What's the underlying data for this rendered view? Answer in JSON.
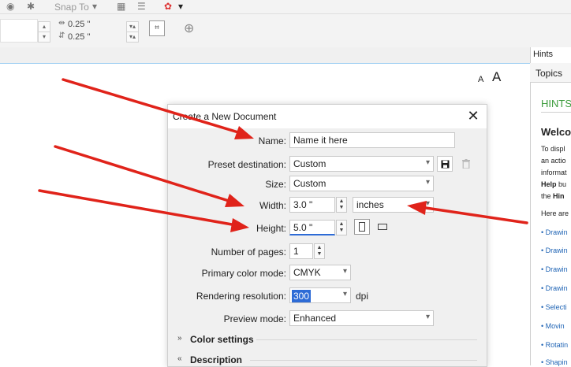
{
  "toolbar": {
    "snap_to_label": "Snap To",
    "nudge_x": "0.25 \"",
    "nudge_y": "0.25 \"",
    "add_icon": "plus-circle-icon"
  },
  "font_size": {
    "small": "A",
    "large": "A"
  },
  "hints": {
    "panel_title": "Hints",
    "tab_label": "Topics",
    "heading": "HINTS",
    "welcome": "Welco",
    "body_lines": [
      "To displ",
      "an actio",
      "informat"
    ],
    "help_line_bold": "Help",
    "help_line_rest": " bu",
    "hint_line_prefix": "the ",
    "hint_line_bold": "Hin",
    "here_line": "Here are",
    "links": [
      "• Drawin",
      "• Drawin",
      "• Drawin",
      "• Drawin",
      "• Selecti",
      "• Movin",
      "• Rotatin",
      "• Shapin"
    ]
  },
  "dialog": {
    "title": "Create a New Document",
    "name_label": "Name:",
    "name_value": "Name it here",
    "preset_label": "Preset destination:",
    "preset_value": "Custom",
    "size_label": "Size:",
    "size_value": "Custom",
    "width_label": "Width:",
    "width_value": "3.0 \"",
    "units_value": "inches",
    "height_label": "Height:",
    "height_value": "5.0 \"",
    "pages_label": "Number of pages:",
    "pages_value": "1",
    "color_mode_label": "Primary color mode:",
    "color_mode_value": "CMYK",
    "resolution_label": "Rendering resolution:",
    "resolution_value": "300",
    "resolution_unit": "dpi",
    "preview_label": "Preview mode:",
    "preview_value": "Enhanced",
    "color_settings_label": "Color settings",
    "description_label": "Description"
  },
  "colors": {
    "arrow": "#e0231a",
    "accent_blue": "#9ecff2",
    "hints_heading": "#3b9b3b",
    "link": "#1f64b5"
  }
}
